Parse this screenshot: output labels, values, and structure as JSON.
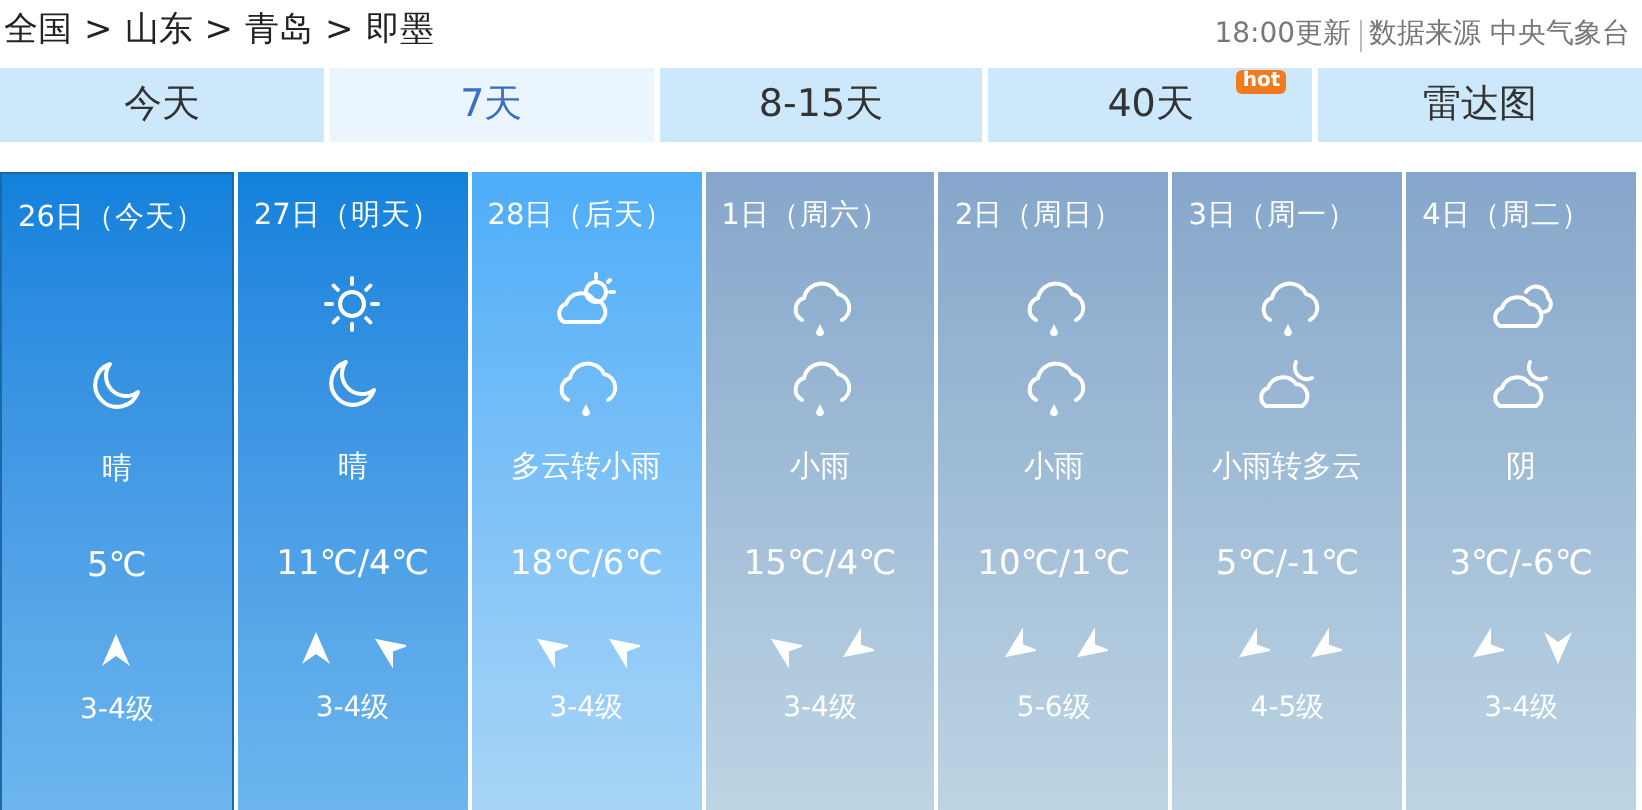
{
  "breadcrumb": [
    "全国",
    "山东",
    "青岛",
    "即墨"
  ],
  "breadcrumb_separator": ">",
  "update_time": "18:00更新",
  "source": "数据来源 中央气象台",
  "tabs": [
    {
      "label": "今天",
      "selected": false
    },
    {
      "label": "7天",
      "selected": true
    },
    {
      "label": "8-15天",
      "selected": false
    },
    {
      "label": "40天",
      "selected": false,
      "badge": "hot"
    },
    {
      "label": "雷达图",
      "selected": false
    }
  ],
  "days": [
    {
      "date": "26日（今天）",
      "selected": true,
      "kind": "sunny",
      "night_icon": {
        "kind": "moon"
      },
      "weather": "晴",
      "temp": "5℃",
      "wind": [
        {
          "kind": "n"
        }
      ],
      "wind_level": "3-4级"
    },
    {
      "date": "27日（明天）",
      "selected": false,
      "kind": "sunny",
      "day_icon": {
        "kind": "sun"
      },
      "night_icon": {
        "kind": "moon"
      },
      "weather": "晴",
      "temp": "11℃/4℃",
      "wind": [
        {
          "kind": "n"
        },
        {
          "kind": "nw"
        }
      ],
      "wind_level": "3-4级"
    },
    {
      "date": "28日（后天）",
      "selected": false,
      "kind": "cloudy",
      "day_icon": {
        "kind": "cloudsun"
      },
      "night_icon": {
        "kind": "rain"
      },
      "weather": "多云转小雨",
      "temp": "18℃/6℃",
      "wind": [
        {
          "kind": "nw"
        },
        {
          "kind": "nw"
        }
      ],
      "wind_level": "3-4级"
    },
    {
      "date": "1日（周六）",
      "selected": false,
      "kind": "rainy",
      "day_icon": {
        "kind": "rain"
      },
      "night_icon": {
        "kind": "rain"
      },
      "weather": "小雨",
      "temp": "15℃/4℃",
      "wind": [
        {
          "kind": "nw"
        },
        {
          "kind": "sw"
        }
      ],
      "wind_level": "3-4级"
    },
    {
      "date": "2日（周日）",
      "selected": false,
      "kind": "rainy",
      "day_icon": {
        "kind": "rain"
      },
      "night_icon": {
        "kind": "rain"
      },
      "weather": "小雨",
      "temp": "10℃/1℃",
      "wind": [
        {
          "kind": "sw"
        },
        {
          "kind": "sw"
        }
      ],
      "wind_level": "5-6级"
    },
    {
      "date": "3日（周一）",
      "selected": false,
      "kind": "rainy",
      "day_icon": {
        "kind": "rain"
      },
      "night_icon": {
        "kind": "cloudmoon"
      },
      "weather": "小雨转多云",
      "temp": "5℃/-1℃",
      "wind": [
        {
          "kind": "sw"
        },
        {
          "kind": "sw"
        }
      ],
      "wind_level": "4-5级"
    },
    {
      "date": "4日（周二）",
      "selected": false,
      "kind": "rainy",
      "day_icon": {
        "kind": "clouds"
      },
      "night_icon": {
        "kind": "cloudmoon"
      },
      "weather": "阴",
      "temp": "3℃/-6℃",
      "wind": [
        {
          "kind": "sw"
        },
        {
          "kind": "s"
        }
      ],
      "wind_level": "3-4级"
    }
  ]
}
